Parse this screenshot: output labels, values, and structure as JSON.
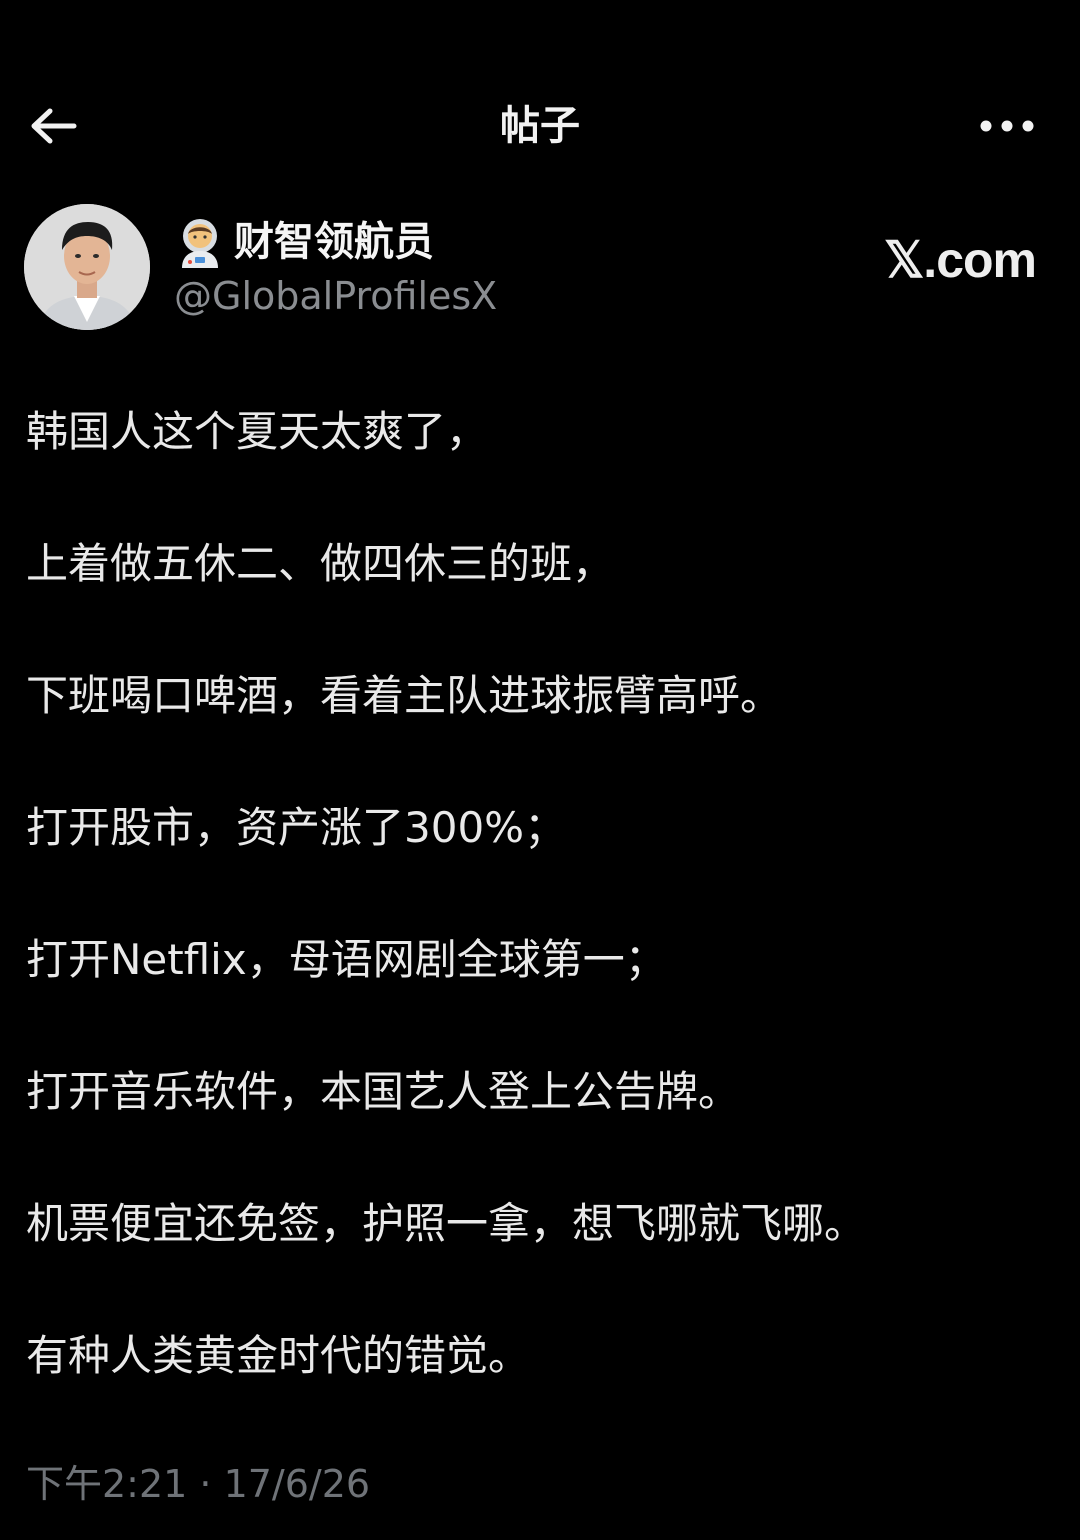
{
  "header": {
    "title": "帖子",
    "back_icon": "arrow-left-icon",
    "more_icon": "more-horizontal-icon"
  },
  "author": {
    "emoji_icon": "astronaut-emoji-icon",
    "display_name": "财智领航员",
    "handle": "@GlobalProfilesX",
    "avatar": "avatar-photo"
  },
  "watermark": {
    "text": "𝕏.com"
  },
  "post": {
    "lines": [
      "韩国人这个夏天太爽了，",
      "上着做五休二、做四休三的班，",
      "下班喝口啤酒，看着主队进球振臂高呼。",
      "打开股市，资产涨了300%；",
      "打开Netflix，母语网剧全球第一；",
      "打开音乐软件，本国艺人登上公告牌。",
      "机票便宜还免签，护照一拿，想飞哪就飞哪。",
      "有种人类黄金时代的错觉。"
    ],
    "timestamp": "下午2:21 · 17/6/26"
  },
  "colors": {
    "background": "#000000",
    "text_primary": "#e9e9e9",
    "text_secondary": "#8a8d91",
    "timestamp": "#6f7378"
  }
}
